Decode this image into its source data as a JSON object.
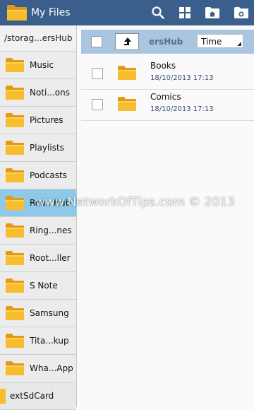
{
  "app": {
    "title": "My Files",
    "icon": "folder-app-icon"
  },
  "actionbar": {
    "buttons": [
      "search-icon",
      "view-grid-icon",
      "home-folder-icon",
      "add-folder-icon"
    ]
  },
  "sidebar": {
    "path": "/storag...ersHub",
    "items": [
      {
        "label": "Music"
      },
      {
        "label": "Noti...ons"
      },
      {
        "label": "Pictures"
      },
      {
        "label": "Playlists"
      },
      {
        "label": "Podcasts"
      },
      {
        "label": "Rea...Hub",
        "selected": true
      },
      {
        "label": "Ring...nes"
      },
      {
        "label": "Root...ller"
      },
      {
        "label": "S Note"
      },
      {
        "label": "Samsung"
      },
      {
        "label": "Tita...kup"
      },
      {
        "label": "Wha...App"
      },
      {
        "label": "extSdCard"
      }
    ]
  },
  "toolbar": {
    "current_folder": "ersHub",
    "sort_by": "Time"
  },
  "files": [
    {
      "name": "Books",
      "date": "18/10/2013 17:13"
    },
    {
      "name": "Comics",
      "date": "18/10/2013 17:13"
    }
  ],
  "watermark": "www.NetworkOfTips.com © 2013",
  "colors": {
    "actionbar": "#3b5f8c",
    "selected": "#8ec9e8",
    "toolbar": "#a9c5df",
    "folder": "#f4b92b"
  }
}
